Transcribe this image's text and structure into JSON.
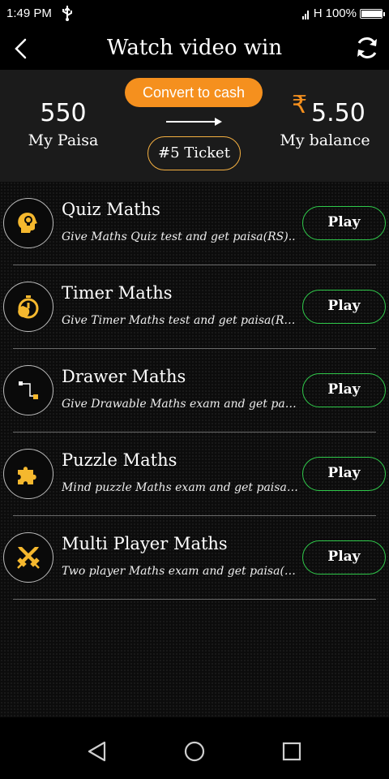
{
  "status_bar": {
    "time": "1:49 PM",
    "network": "H",
    "battery": "100%",
    "battery_level": 1.0
  },
  "app_bar": {
    "title": "Watch video win",
    "back_icon": "back-chevron-icon",
    "refresh_icon": "refresh-icon"
  },
  "wallet": {
    "convert_label": "Convert to cash",
    "paisa_value": "550",
    "paisa_label": "My Paisa",
    "currency_symbol": "₹",
    "balance_value": "5.50",
    "balance_label": "My balance",
    "ticket_label": "#5 Ticket",
    "accent_color": "#f5901e"
  },
  "games": [
    {
      "name": "Quiz Maths",
      "description": "Give Maths Quiz test and get paisa(RS)..",
      "play_label": "Play",
      "icon": "quiz-brain-icon"
    },
    {
      "name": "Timer Maths",
      "description": "Give Timer Maths test and get paisa(RS)..",
      "play_label": "Play",
      "icon": "stopwatch-icon"
    },
    {
      "name": "Drawer Maths",
      "description": "Give Drawable Maths exam and get paisa(RS)..",
      "play_label": "Play",
      "icon": "draw-path-icon"
    },
    {
      "name": "Puzzle Maths",
      "description": "Mind puzzle Maths exam and get paisa(RS)..",
      "play_label": "Play",
      "icon": "puzzle-piece-icon"
    },
    {
      "name": "Multi Player Maths",
      "description": "Two player Maths exam and get paisa(RS)..",
      "play_label": "Play",
      "icon": "crossed-swords-icon"
    }
  ],
  "colors": {
    "icon_gold": "#f5b82e",
    "play_border": "#2fc84a"
  },
  "nav_bar": {
    "back": "nav-back-icon",
    "home": "nav-home-icon",
    "recents": "nav-recents-icon"
  }
}
